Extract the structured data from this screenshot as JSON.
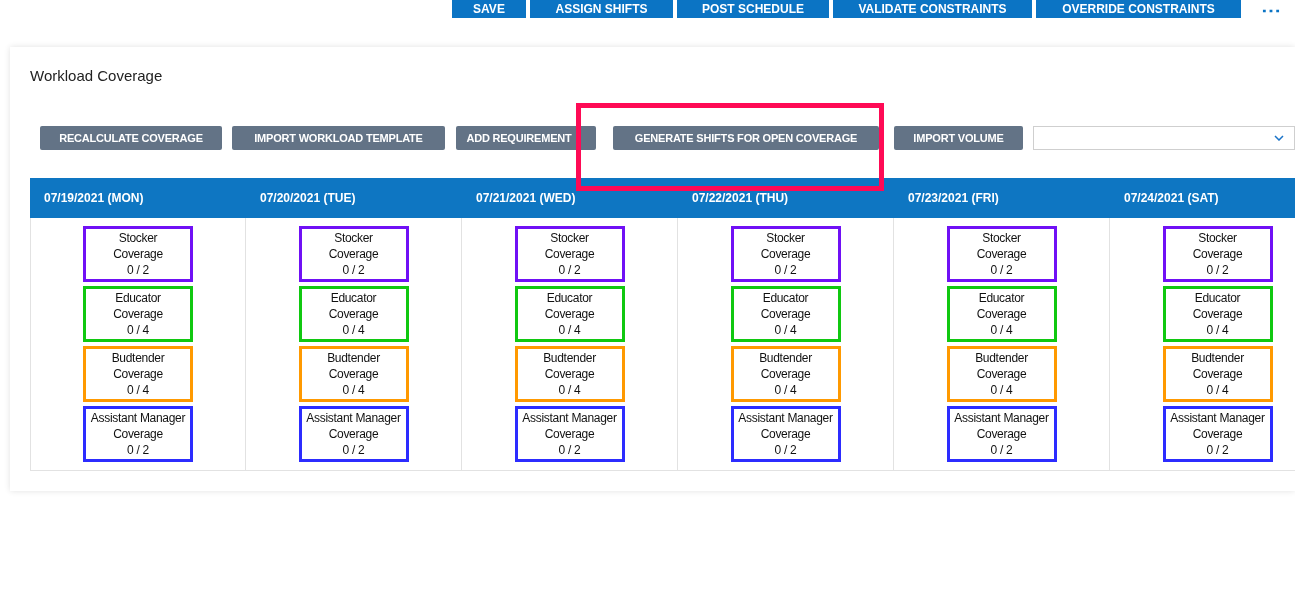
{
  "top_actions": [
    "SAVE",
    "ASSIGN SHIFTS",
    "POST SCHEDULE",
    "VALIDATE CONSTRAINTS",
    "OVERRIDE CONSTRAINTS"
  ],
  "more_menu": "⋯",
  "panel": {
    "title": "Workload Coverage",
    "toolbar": [
      {
        "label": "RECALCULATE COVERAGE",
        "highlighted": false
      },
      {
        "label": "IMPORT WORKLOAD TEMPLATE",
        "highlighted": false
      },
      {
        "label": "ADD REQUIREMENT",
        "highlighted": false
      },
      {
        "label": "GENERATE SHIFTS FOR OPEN COVERAGE",
        "highlighted": true
      },
      {
        "label": "IMPORT VOLUME",
        "highlighted": false
      }
    ],
    "days": [
      {
        "header": "07/19/2021 (MON)",
        "coverage": [
          {
            "role": "Stocker",
            "label": "Coverage",
            "count": "0 / 2",
            "color": "#7010f5"
          },
          {
            "role": "Educator",
            "label": "Coverage",
            "count": "0 / 4",
            "color": "#10c810"
          },
          {
            "role": "Budtender",
            "label": "Coverage",
            "count": "0 / 4",
            "color": "#ff9900"
          },
          {
            "role": "Assistant Manager",
            "label": "Coverage",
            "count": "0 / 2",
            "color": "#2c2cff"
          }
        ]
      },
      {
        "header": "07/20/2021 (TUE)",
        "coverage": [
          {
            "role": "Stocker",
            "label": "Coverage",
            "count": "0 / 2",
            "color": "#7010f5"
          },
          {
            "role": "Educator",
            "label": "Coverage",
            "count": "0 / 4",
            "color": "#10c810"
          },
          {
            "role": "Budtender",
            "label": "Coverage",
            "count": "0 / 4",
            "color": "#ff9900"
          },
          {
            "role": "Assistant Manager",
            "label": "Coverage",
            "count": "0 / 2",
            "color": "#2c2cff"
          }
        ]
      },
      {
        "header": "07/21/2021 (WED)",
        "coverage": [
          {
            "role": "Stocker",
            "label": "Coverage",
            "count": "0 / 2",
            "color": "#7010f5"
          },
          {
            "role": "Educator",
            "label": "Coverage",
            "count": "0 / 4",
            "color": "#10c810"
          },
          {
            "role": "Budtender",
            "label": "Coverage",
            "count": "0 / 4",
            "color": "#ff9900"
          },
          {
            "role": "Assistant Manager",
            "label": "Coverage",
            "count": "0 / 2",
            "color": "#2c2cff"
          }
        ]
      },
      {
        "header": "07/22/2021 (THU)",
        "coverage": [
          {
            "role": "Stocker",
            "label": "Coverage",
            "count": "0 / 2",
            "color": "#7010f5"
          },
          {
            "role": "Educator",
            "label": "Coverage",
            "count": "0 / 4",
            "color": "#10c810"
          },
          {
            "role": "Budtender",
            "label": "Coverage",
            "count": "0 / 4",
            "color": "#ff9900"
          },
          {
            "role": "Assistant Manager",
            "label": "Coverage",
            "count": "0 / 2",
            "color": "#2c2cff"
          }
        ]
      },
      {
        "header": "07/23/2021 (FRI)",
        "coverage": [
          {
            "role": "Stocker",
            "label": "Coverage",
            "count": "0 / 2",
            "color": "#7010f5"
          },
          {
            "role": "Educator",
            "label": "Coverage",
            "count": "0 / 4",
            "color": "#10c810"
          },
          {
            "role": "Budtender",
            "label": "Coverage",
            "count": "0 / 4",
            "color": "#ff9900"
          },
          {
            "role": "Assistant Manager",
            "label": "Coverage",
            "count": "0 / 2",
            "color": "#2c2cff"
          }
        ]
      },
      {
        "header": "07/24/2021 (SAT)",
        "coverage": [
          {
            "role": "Stocker",
            "label": "Coverage",
            "count": "0 / 2",
            "color": "#7010f5"
          },
          {
            "role": "Educator",
            "label": "Coverage",
            "count": "0 / 4",
            "color": "#10c810"
          },
          {
            "role": "Budtender",
            "label": "Coverage",
            "count": "0 / 4",
            "color": "#ff9900"
          },
          {
            "role": "Assistant Manager",
            "label": "Coverage",
            "count": "0 / 2",
            "color": "#2c2cff"
          }
        ]
      }
    ]
  }
}
